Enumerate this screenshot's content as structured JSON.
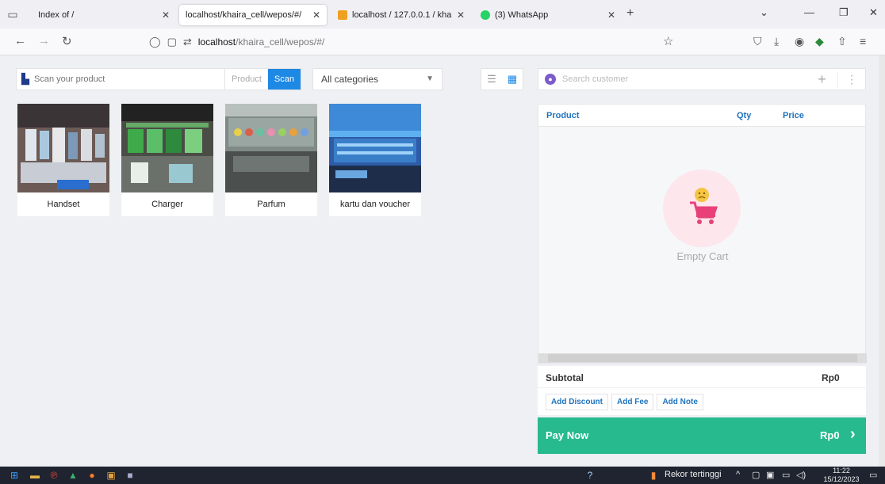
{
  "browser": {
    "tabs": [
      {
        "label": "Index of /",
        "active": false
      },
      {
        "label": "localhost/khaira_cell/wepos/#/",
        "active": true
      },
      {
        "label": "localhost / 127.0.0.1 / khaira_ce",
        "active": false
      },
      {
        "label": "(3) WhatsApp",
        "active": false
      }
    ],
    "url_host": "localhost",
    "url_path": "/khaira_cell/wepos/#/"
  },
  "pos": {
    "scan_placeholder": "Scan your product",
    "mode_label": "Product",
    "scan_button": "Scan",
    "category_selected": "All categories",
    "products": [
      {
        "name": "Handset"
      },
      {
        "name": "Charger"
      },
      {
        "name": "Parfum"
      },
      {
        "name": "kartu dan voucher"
      }
    ]
  },
  "cart": {
    "customer_placeholder": "Search customer",
    "headers": {
      "product": "Product",
      "qty": "Qty",
      "price": "Price"
    },
    "empty_text": "Empty Cart",
    "subtotal_label": "Subtotal",
    "subtotal_value": "Rp0",
    "actions": [
      "Add Discount",
      "Add Fee",
      "Add Note"
    ],
    "pay_label": "Pay Now",
    "pay_value": "Rp0"
  },
  "taskbar": {
    "weather": "Rekor tertinggi",
    "time": "11:22",
    "date": "15/12/2023"
  },
  "colors": {
    "accent": "#1e88e5",
    "pay": "#26ba8e",
    "header_text": "#1e73be"
  }
}
